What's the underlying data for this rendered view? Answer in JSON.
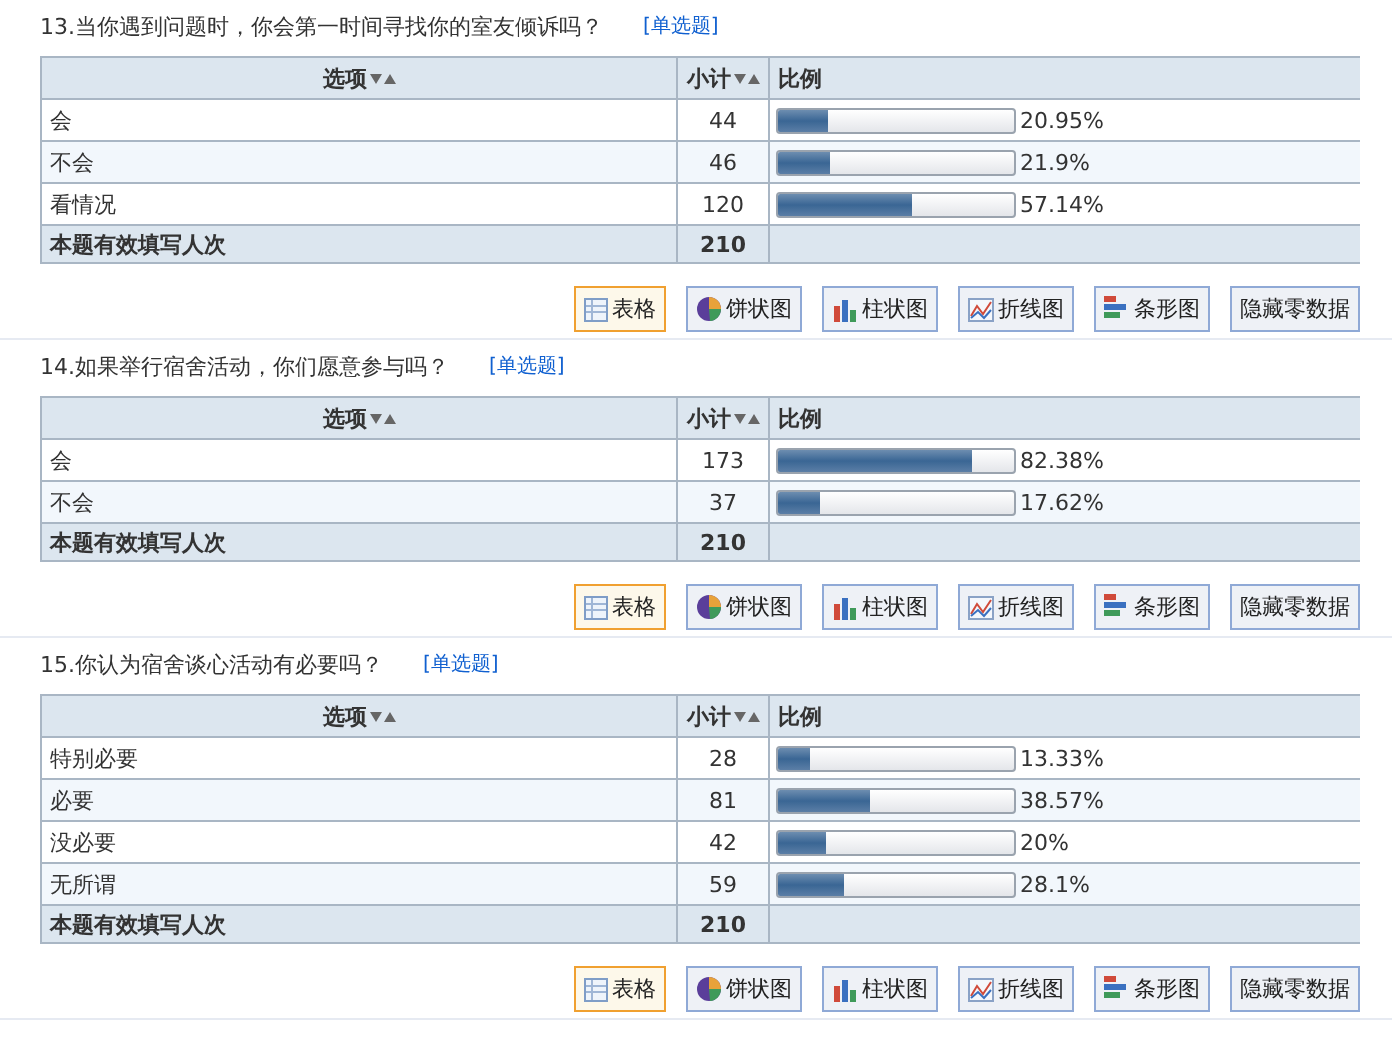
{
  "questions": [
    {
      "title": "13.当你遇到问题时，你会第一时间寻找你的室友倾诉吗？",
      "type_label": "[单选题]",
      "columns": [
        "选项",
        "小计",
        "比例"
      ],
      "rows": [
        {
          "option": "会",
          "count": "44",
          "level": 0.2095,
          "percent": "20.95%"
        },
        {
          "option": "不会",
          "count": "46",
          "level": 0.219,
          "percent": "21.9%"
        },
        {
          "option": "看情况",
          "count": "120",
          "level": 0.5714,
          "percent": "57.14%"
        }
      ],
      "total_label": "本题有效填写人次",
      "total": "210",
      "buttons": [
        {
          "kind": "table",
          "label": "表格",
          "selected": true
        },
        {
          "kind": "pie",
          "label": "饼状图",
          "selected": false
        },
        {
          "kind": "bar",
          "label": "柱状图",
          "selected": false
        },
        {
          "kind": "line",
          "label": "折线图",
          "selected": false
        },
        {
          "kind": "barh",
          "label": "条形图",
          "selected": false
        },
        {
          "kind": "text",
          "label": "隐藏零数据",
          "selected": false
        }
      ]
    },
    {
      "title": "14.如果举行宿舍活动，你们愿意参与吗？",
      "type_label": "[单选题]",
      "columns": [
        "选项",
        "小计",
        "比例"
      ],
      "rows": [
        {
          "option": "会",
          "count": "173",
          "level": 0.8238,
          "percent": "82.38%"
        },
        {
          "option": "不会",
          "count": "37",
          "level": 0.1762,
          "percent": "17.62%"
        }
      ],
      "total_label": "本题有效填写人次",
      "total": "210",
      "buttons": [
        {
          "kind": "table",
          "label": "表格",
          "selected": true
        },
        {
          "kind": "pie",
          "label": "饼状图",
          "selected": false
        },
        {
          "kind": "bar",
          "label": "柱状图",
          "selected": false
        },
        {
          "kind": "line",
          "label": "折线图",
          "selected": false
        },
        {
          "kind": "barh",
          "label": "条形图",
          "selected": false
        },
        {
          "kind": "text",
          "label": "隐藏零数据",
          "selected": false
        }
      ]
    },
    {
      "title": "15.你认为宿舍谈心活动有必要吗？",
      "type_label": "[单选题]",
      "columns": [
        "选项",
        "小计",
        "比例"
      ],
      "rows": [
        {
          "option": "特别必要",
          "count": "28",
          "level": 0.1333,
          "percent": "13.33%"
        },
        {
          "option": "必要",
          "count": "81",
          "level": 0.3857,
          "percent": "38.57%"
        },
        {
          "option": "没必要",
          "count": "42",
          "level": 0.2,
          "percent": "20%"
        },
        {
          "option": "无所谓",
          "count": "59",
          "level": 0.281,
          "percent": "28.1%"
        }
      ],
      "total_label": "本题有效填写人次",
      "total": "210",
      "buttons": [
        {
          "kind": "table",
          "label": "表格",
          "selected": true
        },
        {
          "kind": "pie",
          "label": "饼状图",
          "selected": false
        },
        {
          "kind": "bar",
          "label": "柱状图",
          "selected": false
        },
        {
          "kind": "line",
          "label": "折线图",
          "selected": false
        },
        {
          "kind": "barh",
          "label": "条形图",
          "selected": false
        },
        {
          "kind": "text",
          "label": "隐藏零数据",
          "selected": false
        }
      ]
    }
  ]
}
